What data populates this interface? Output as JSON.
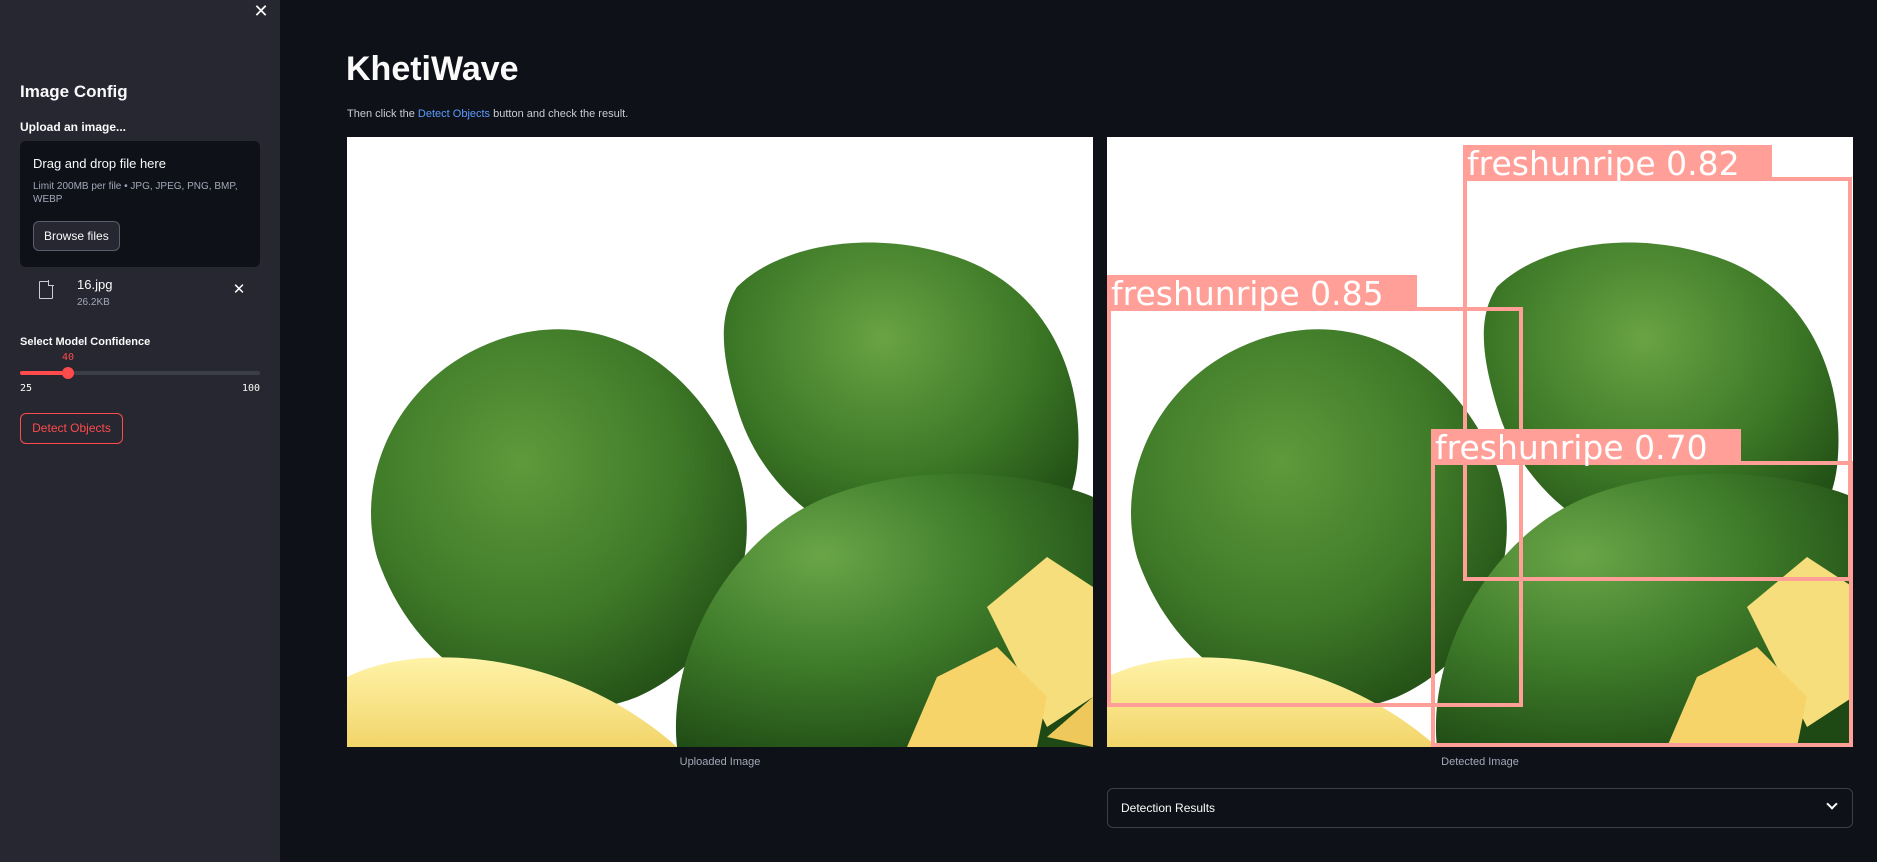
{
  "sidebar": {
    "title": "Image Config",
    "upload_label": "Upload an image...",
    "dropzone": {
      "title": "Drag and drop file here",
      "limit": "Limit 200MB per file • JPG, JPEG, PNG, BMP, WEBP",
      "browse_label": "Browse files"
    },
    "file": {
      "name": "16.jpg",
      "size": "26.2KB"
    },
    "confidence": {
      "label": "Select Model Confidence",
      "value": 40,
      "min": 25,
      "max": 100
    },
    "detect_button": "Detect Objects"
  },
  "main": {
    "title": "KhetiWave",
    "instruction": {
      "before": "Then click the ",
      "link": "Detect Objects",
      "after": " button and check the result."
    },
    "uploaded_caption": "Uploaded Image",
    "detected_caption": "Detected Image",
    "detections": [
      {
        "label": "freshunripe 0.82"
      },
      {
        "label": "freshunripe 0.85"
      },
      {
        "label": "freshunripe 0.70"
      }
    ],
    "results_expander": "Detection Results"
  },
  "colors": {
    "accent": "#ff4b4b",
    "link": "#5b9cff",
    "box": "#ff9f97"
  }
}
